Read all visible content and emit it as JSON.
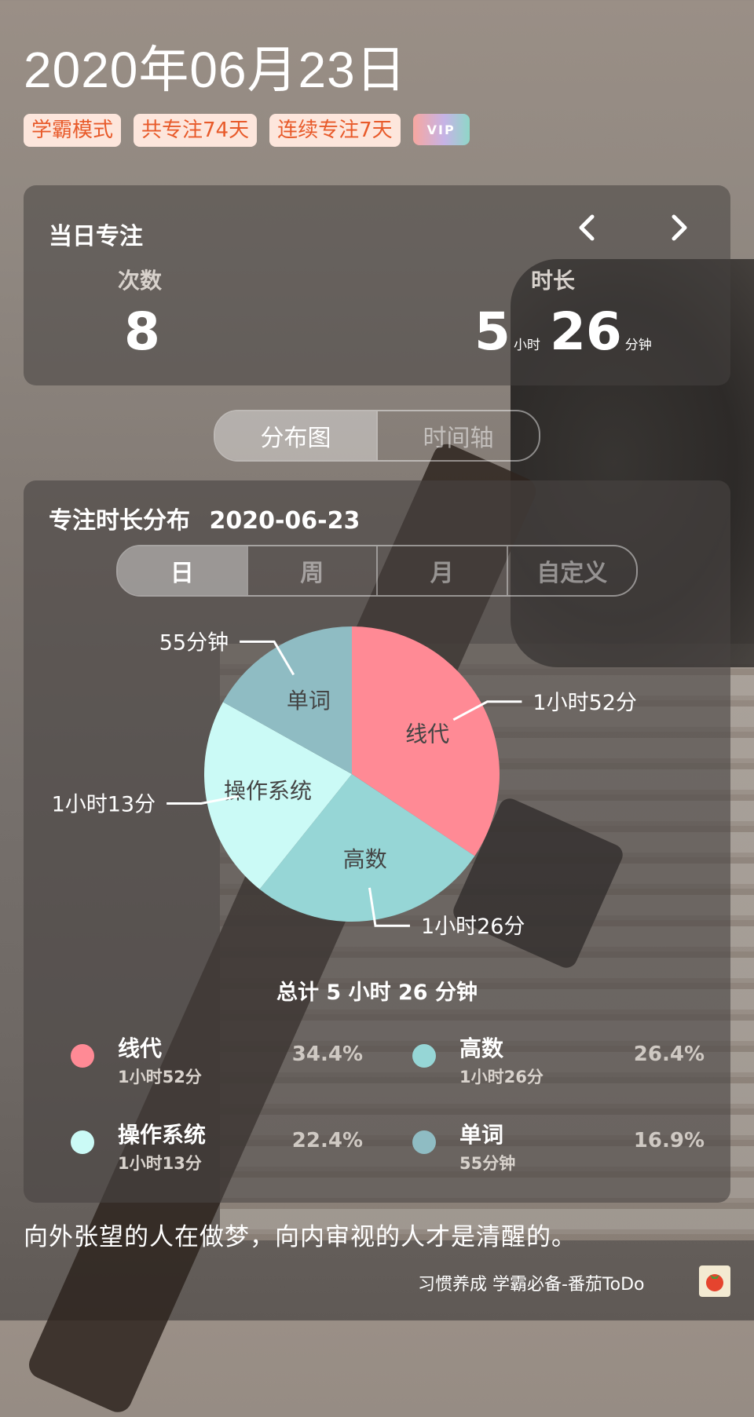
{
  "header": {
    "date": "2020年06月23日",
    "badges": [
      "学霸模式",
      "共专注74天",
      "连续专注7天"
    ],
    "vip_label": "VIP"
  },
  "daily_focus": {
    "title": "当日专注",
    "count_label": "次数",
    "count_value": "8",
    "duration_label": "时长",
    "duration_hours": "5",
    "hours_unit": "小时",
    "duration_minutes": "26",
    "minutes_unit": "分钟"
  },
  "view_tabs": [
    "分布图",
    "时间轴"
  ],
  "distribution": {
    "title": "专注时长分布",
    "date": "2020-06-23",
    "range_tabs": [
      "日",
      "周",
      "月",
      "自定义"
    ],
    "total_label": "总计 5 小时 26 分钟"
  },
  "chart_data": {
    "type": "pie",
    "slices": [
      {
        "name": "线代",
        "value": 34.4,
        "duration": "1小时52分",
        "color": "#ff8a95"
      },
      {
        "name": "高数",
        "value": 26.4,
        "duration": "1小时26分",
        "color": "#96d6d6"
      },
      {
        "name": "操作系统",
        "value": 22.4,
        "duration": "1小时13分",
        "color": "#cbfaf6"
      },
      {
        "name": "单词",
        "value": 16.9,
        "duration": "55分钟",
        "color": "#8fbcc3"
      }
    ]
  },
  "legend": [
    {
      "name": "线代",
      "time": "1小时52分",
      "pct": "34.4%",
      "color": "#ff8a95"
    },
    {
      "name": "高数",
      "time": "1小时26分",
      "pct": "26.4%",
      "color": "#96d6d6"
    },
    {
      "name": "操作系统",
      "time": "1小时13分",
      "pct": "22.4%",
      "color": "#cbfaf6"
    },
    {
      "name": "单词",
      "time": "55分钟",
      "pct": "16.9%",
      "color": "#8fbcc3"
    }
  ],
  "quote": "向外张望的人在做梦，向内审视的人才是清醒的。",
  "footer": {
    "text": "习惯养成 学霸必备-番茄ToDo",
    "icon": "tomato-icon"
  }
}
